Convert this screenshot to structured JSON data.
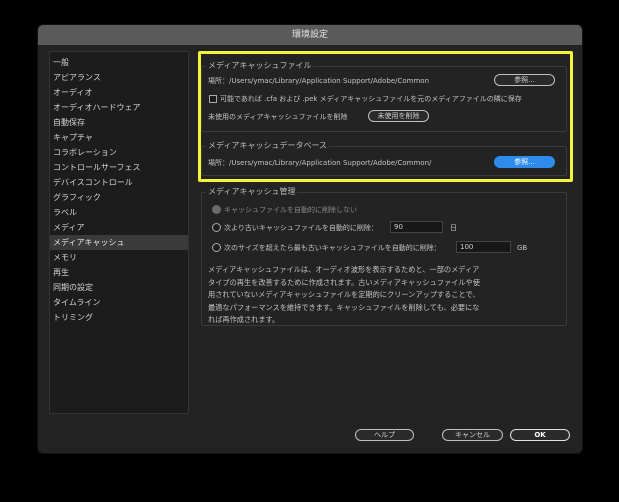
{
  "window": {
    "title": "環境設定"
  },
  "sidebar": {
    "items": [
      {
        "label": "一般",
        "selected": false
      },
      {
        "label": "アピアランス",
        "selected": false
      },
      {
        "label": "オーディオ",
        "selected": false
      },
      {
        "label": "オーディオハードウェア",
        "selected": false
      },
      {
        "label": "自動保存",
        "selected": false
      },
      {
        "label": "キャプチャ",
        "selected": false
      },
      {
        "label": "コラボレーション",
        "selected": false
      },
      {
        "label": "コントロールサーフェス",
        "selected": false
      },
      {
        "label": "デバイスコントロール",
        "selected": false
      },
      {
        "label": "グラフィック",
        "selected": false
      },
      {
        "label": "ラベル",
        "selected": false
      },
      {
        "label": "メディア",
        "selected": false
      },
      {
        "label": "メディアキャッシュ",
        "selected": true
      },
      {
        "label": "メモリ",
        "selected": false
      },
      {
        "label": "再生",
        "selected": false
      },
      {
        "label": "同期の設定",
        "selected": false
      },
      {
        "label": "タイムライン",
        "selected": false
      },
      {
        "label": "トリミング",
        "selected": false
      }
    ]
  },
  "cache_files": {
    "title": "メディアキャッシュファイル",
    "location": "場所：/Users/ymac/Library/Application Support/Adobe/Common",
    "browse_label": "参照...",
    "save_next_to_original": "可能であれば .cfa および .pek メディアキャッシュファイルを元のメディアファイルの隣に保存",
    "delete_unused_text": "未使用のメディアキャッシュファイルを削除",
    "delete_unused_button": "未使用を削除"
  },
  "cache_db": {
    "title": "メディアキャッシュデータベース",
    "location": "場所：/Users/ymac/Library/Application Support/Adobe/Common/",
    "browse_label": "参照..."
  },
  "cache_mgmt": {
    "title": "メディアキャッシュ管理",
    "option_never": "キャッシュファイルを自動的に削除しない",
    "option_older_than": "次より古いキャッシュファイルを自動的に削除：",
    "days_value": "90",
    "days_unit": "日",
    "option_size": "次のサイズを超えたら最も古いキャッシュファイルを自動的に削除：",
    "size_value": "100",
    "size_unit": "GB",
    "description_lines": [
      "メディアキャッシュファイルは、オーディオ波形を表示するためと、一部のメディア",
      "タイプの再生を改善するために作成されます。古いメディアキャッシュファイルや使",
      "用されていないメディアキャッシュファイルを定期的にクリーンアップすることで、",
      "最適なパフォーマンスを維持できます。キャッシュファイルを削除しても、必要にな",
      "れば再作成されます。"
    ]
  },
  "footer": {
    "help_label": "ヘルプ",
    "cancel_label": "キャンセル",
    "ok_label": "OK"
  },
  "colors": {
    "highlight": "#f5f33a",
    "primary_button": "#2d8ceb"
  }
}
